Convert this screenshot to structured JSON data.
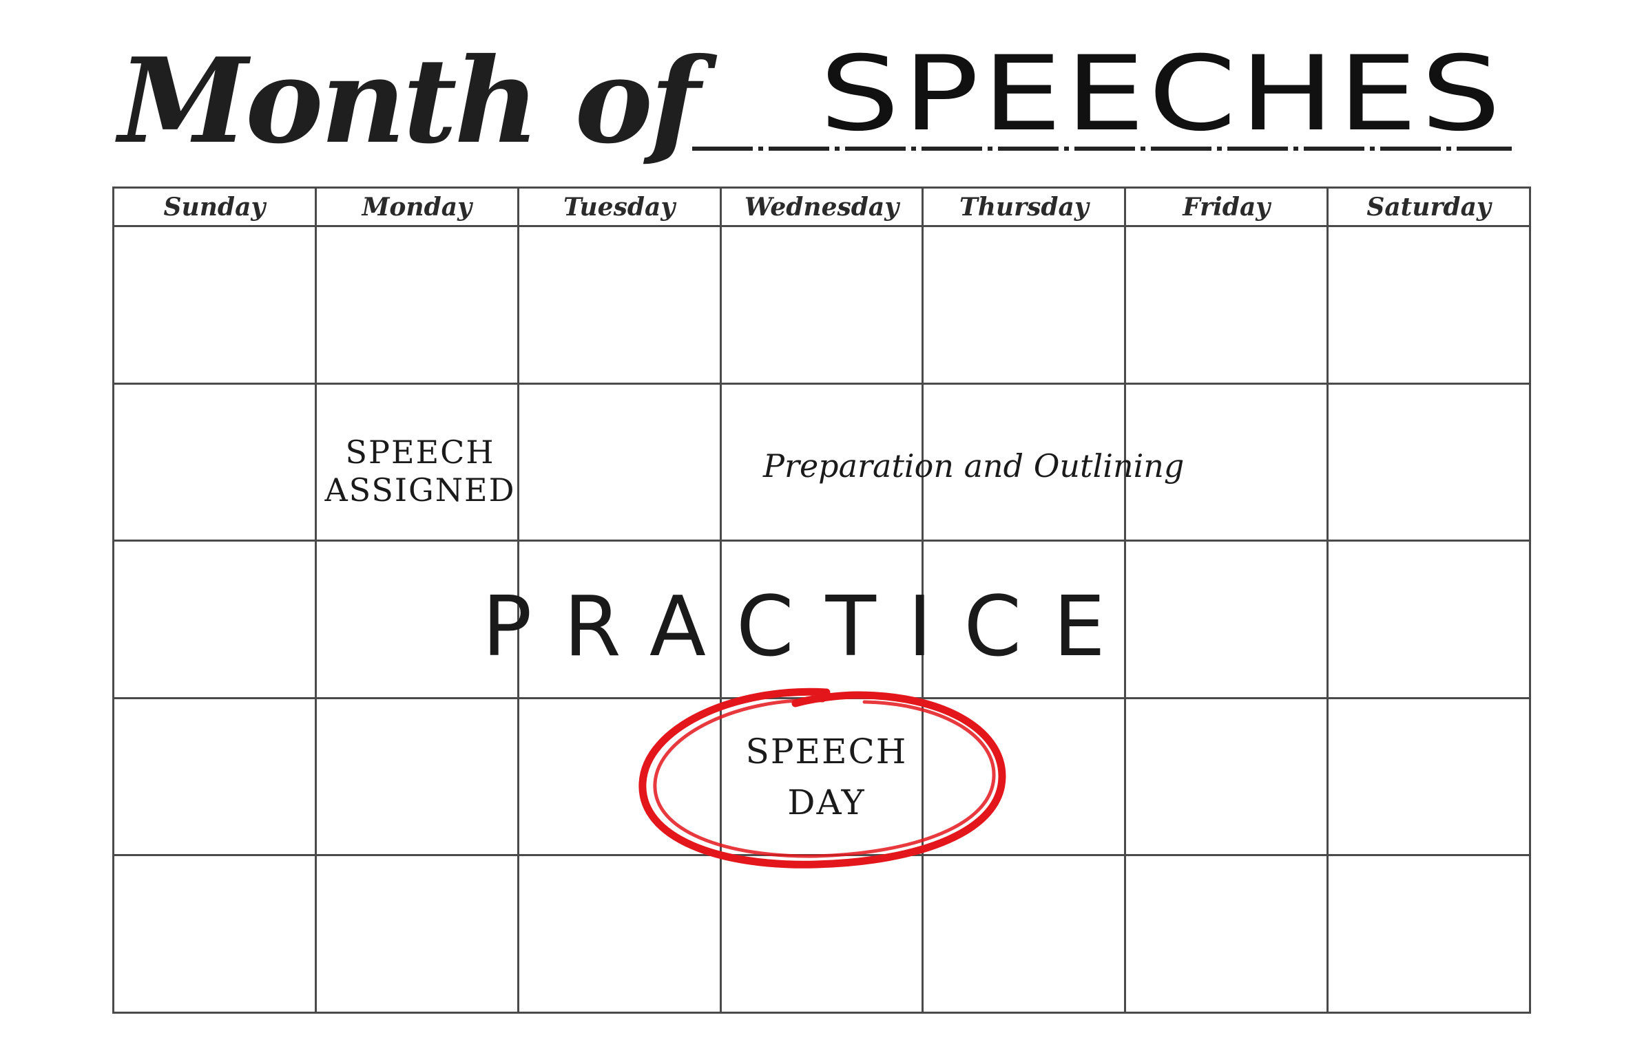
{
  "title": {
    "prefix": "Month of",
    "value": "SPEECHES"
  },
  "calendar": {
    "days": [
      "Sunday",
      "Monday",
      "Tuesday",
      "Wednesday",
      "Thursday",
      "Friday",
      "Saturday"
    ],
    "weeks": 5
  },
  "notes": {
    "speech_assigned": [
      "SPEECH",
      "ASSIGNED"
    ],
    "preparation": "Preparation and Outlining",
    "practice": "PRACTICE",
    "speech_day": [
      "SPEECH",
      "DAY"
    ]
  },
  "colors": {
    "grid_line": "#4a4a4a",
    "ink": "#1a1a1a",
    "highlight_circle": "#e3161c"
  }
}
